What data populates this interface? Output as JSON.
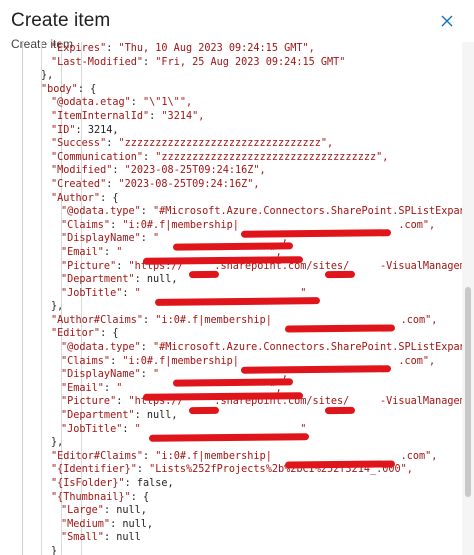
{
  "dialog": {
    "title": "Create item",
    "subtitle": "Create item",
    "close_icon": "close-icon"
  },
  "code_lines": [
    {
      "indent": 3,
      "text": "\"Expires\": \"Thu, 10 Aug 2023 09:24:15 GMT\","
    },
    {
      "indent": 3,
      "text": "\"Last-Modified\": \"Fri, 25 Aug 2023 09:24:15 GMT\""
    },
    {
      "indent": 2,
      "text": "},"
    },
    {
      "indent": 2,
      "text": "\"body\": {"
    },
    {
      "indent": 3,
      "text": "\"@odata.etag\": \"\\\"1\\\"\","
    },
    {
      "indent": 3,
      "text": "\"ItemInternalId\": \"3214\","
    },
    {
      "indent": 3,
      "text": "\"ID\": 3214,"
    },
    {
      "indent": 3,
      "text": "\"Success\": \"zzzzzzzzzzzzzzzzzzzzzzzzzzzzzzzz\","
    },
    {
      "indent": 3,
      "text": "\"Communication\": \"zzzzzzzzzzzzzzzzzzzzzzzzzzzzzzzzzzz\","
    },
    {
      "indent": 3,
      "text": "\"Modified\": \"2023-08-25T09:24:16Z\","
    },
    {
      "indent": 3,
      "text": "\"Created\": \"2023-08-25T09:24:16Z\","
    },
    {
      "indent": 3,
      "text": "\"Author\": {"
    },
    {
      "indent": 4,
      "text": "\"@odata.type\": \"#Microsoft.Azure.Connectors.SharePoint.SPListExpanded"
    },
    {
      "indent": 4,
      "text": "\"Claims\": \"i:0#.f|membership|                          .com\","
    },
    {
      "indent": 4,
      "text": "\"DisplayName\": \"                   \","
    },
    {
      "indent": 4,
      "text": "\"Email\": \"                        \","
    },
    {
      "indent": 4,
      "text": "\"Picture\": \"https://     .sharepoint.com/sites/     -VisualManagement/_l"
    },
    {
      "indent": 4,
      "text": "\"Department\": null,"
    },
    {
      "indent": 4,
      "text": "\"JobTitle\": \"                          \""
    },
    {
      "indent": 3,
      "text": "},"
    },
    {
      "indent": 3,
      "text": "\"Author#Claims\": \"i:0#.f|membership|                     .com\","
    },
    {
      "indent": 3,
      "text": "\"Editor\": {"
    },
    {
      "indent": 4,
      "text": "\"@odata.type\": \"#Microsoft.Azure.Connectors.SharePoint.SPListExpanded"
    },
    {
      "indent": 4,
      "text": "\"Claims\": \"i:0#.f|membership|                          .com\","
    },
    {
      "indent": 4,
      "text": "\"DisplayName\": \"                   \","
    },
    {
      "indent": 4,
      "text": "\"Email\": \"                        \","
    },
    {
      "indent": 4,
      "text": "\"Picture\": \"https://     .sharepoint.com/sites/     -VisualManagement/_l"
    },
    {
      "indent": 4,
      "text": "\"Department\": null,"
    },
    {
      "indent": 4,
      "text": "\"JobTitle\": \"                          \""
    },
    {
      "indent": 3,
      "text": "},"
    },
    {
      "indent": 3,
      "text": "\"Editor#Claims\": \"i:0#.f|membership|                     .com\","
    },
    {
      "indent": 3,
      "text": "\"{Identifier}\": \"Lists%252fProjects%2b%2bCI%252f3214_.000\","
    },
    {
      "indent": 3,
      "text": "\"{IsFolder}\": false,"
    },
    {
      "indent": 3,
      "text": "\"{Thumbnail}\": {"
    },
    {
      "indent": 4,
      "text": "\"Large\": null,"
    },
    {
      "indent": 4,
      "text": "\"Medium\": null,"
    },
    {
      "indent": 4,
      "text": "\"Small\": null"
    },
    {
      "indent": 3,
      "text": "}"
    }
  ],
  "colors": {
    "key": "#a31515",
    "redaction": "#e0151b",
    "guide": "#d9d9d9"
  }
}
